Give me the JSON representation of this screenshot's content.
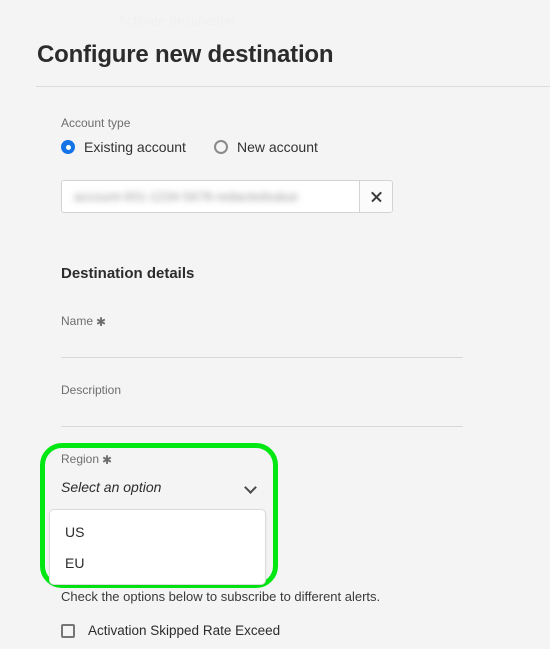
{
  "page": {
    "ghost_breadcrumb": "Activate destination",
    "title": "Configure new destination"
  },
  "account_type": {
    "label": "Account type",
    "options": [
      {
        "label": "Existing account",
        "selected": true
      },
      {
        "label": "New account",
        "selected": false
      }
    ],
    "selected_account_value": "account-001-1234-5678-redactedvalue",
    "clear_icon": "close-icon"
  },
  "destination_details": {
    "heading": "Destination details",
    "fields": [
      {
        "label": "Name",
        "required": true,
        "required_mark": "✱",
        "value": "",
        "placeholder": ""
      },
      {
        "label": "Description",
        "required": false,
        "required_mark": "",
        "value": "",
        "placeholder": ""
      }
    ]
  },
  "region": {
    "label": "Region",
    "required": true,
    "required_mark": "✱",
    "placeholder": "Select an option",
    "chevron_icon": "chevron-down-icon",
    "expanded": true,
    "options": [
      {
        "label": "US"
      },
      {
        "label": "EU"
      }
    ]
  },
  "alerts": {
    "hint": "Check the options below to subscribe to different alerts.",
    "checkboxes": [
      {
        "label": "Activation Skipped Rate Exceed",
        "checked": false
      }
    ]
  },
  "colors": {
    "background": "#f4f4f4",
    "accent_blue": "#1473e6",
    "highlight_green": "#00e712",
    "text_primary": "#2c2c2c",
    "text_secondary": "#6e6e6e",
    "divider": "#dcdcdc"
  }
}
